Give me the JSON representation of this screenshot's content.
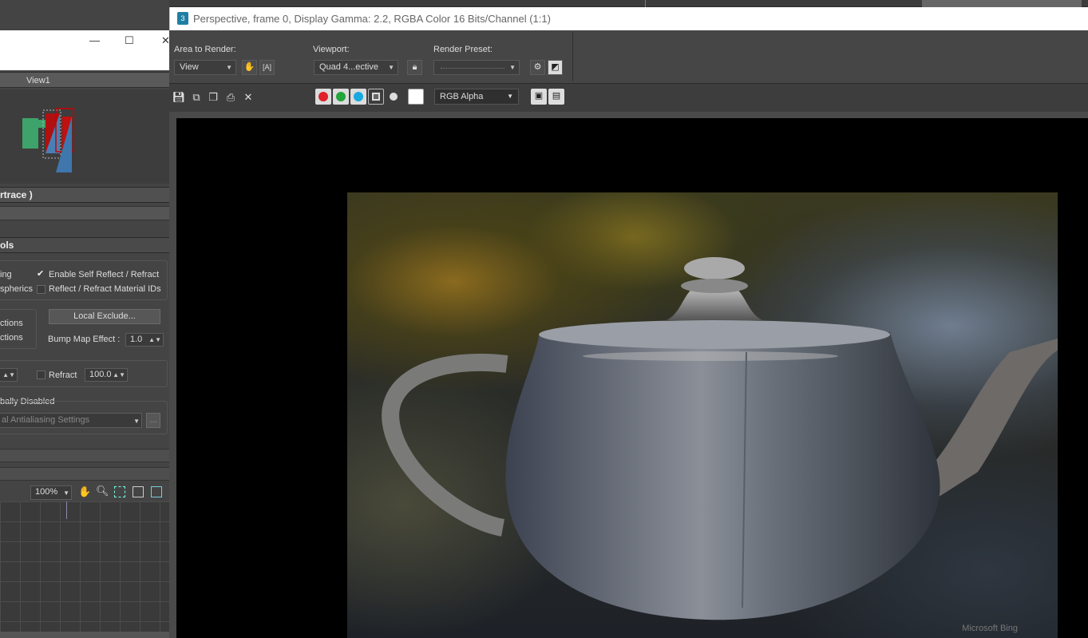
{
  "material_editor": {
    "view_tab": "View1",
    "rollout_title": "rtrace )",
    "controls_title": "ols",
    "options": {
      "row1_left": "ing",
      "row2_left": "spherics",
      "enable_self_reflect": "Enable Self Reflect / Refract",
      "reflect_material_ids": "Reflect / Refract Material IDs",
      "row3_left": "ctions",
      "row4_left": "ctions",
      "local_exclude": "Local Exclude...",
      "bump_label": "Bump Map Effect :",
      "bump_value": "1.0",
      "refract_label": "Refract",
      "refract_value": "100.0",
      "aa_label": "bally Disabled",
      "aa_dropdown": "al Antialiasing Settings",
      "aa_button": "..."
    },
    "zoom": "100%"
  },
  "frame_buffer": {
    "title": "Perspective, frame 0, Display Gamma: 2.2, RGBA Color 16 Bits/Channel (1:1)",
    "app_icon": "3",
    "area_label": "Area to Render:",
    "area_value": "View",
    "viewport_label": "Viewport:",
    "viewport_value": "Quad 4...ective",
    "preset_label": "Render Preset:",
    "preset_value": "",
    "channel": "RGB Alpha",
    "watermark": "Microsoft Bing",
    "colors": {
      "red": "#e0202a",
      "green": "#22a53c",
      "blue": "#18a9e0"
    }
  }
}
